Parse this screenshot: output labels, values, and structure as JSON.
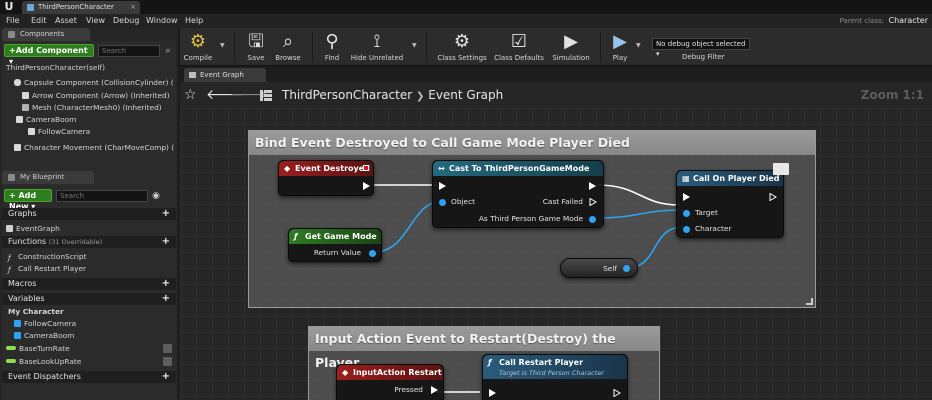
{
  "window": {
    "tab_title": "ThirdPersonCharacter",
    "parent_class_label": "Parent class:",
    "parent_class_value": "Character"
  },
  "menu": [
    "File",
    "Edit",
    "Asset",
    "View",
    "Debug",
    "Window",
    "Help"
  ],
  "components_panel": {
    "tab": "Components",
    "add_button": "+Add Component ▾",
    "search_placeholder": "Search",
    "items": [
      "ThirdPersonCharacter(self)",
      "Capsule Component (CollisionCylinder) (Inherited)",
      "Arrow Component (Arrow) (Inherited)",
      "Mesh (CharacterMesh0) (Inherited)",
      "CameraBoom",
      "FollowCamera",
      "Character Movement (CharMoveComp) (Inherited)"
    ]
  },
  "my_blueprint_panel": {
    "tab": "My Blueprint",
    "add_button": "+ Add New ▾",
    "search_placeholder": "Search",
    "graphs_label": "Graphs",
    "graph_items": [
      "EventGraph"
    ],
    "functions_label": "Functions",
    "functions_count": "(31 Overridable)",
    "function_items": [
      "ConstructionScript",
      "Call Restart Player"
    ],
    "macros_label": "Macros",
    "variables_label": "Variables",
    "variable_category": "My Character",
    "variable_items": [
      "FollowCamera",
      "CameraBoom",
      "BaseTurnRate",
      "BaseLookUpRate"
    ],
    "dispatchers_label": "Event Dispatchers"
  },
  "toolbar": {
    "compile": "Compile",
    "save": "Save",
    "browse": "Browse",
    "find": "Find",
    "hide_unrelated": "Hide Unrelated",
    "class_settings": "Class Settings",
    "class_defaults": "Class Defaults",
    "simulation": "Simulation",
    "play": "Play",
    "debug_object": "No debug object selected ▾",
    "debug_filter": "Debug Filter"
  },
  "graph": {
    "tab": "Event Graph",
    "breadcrumb_root": "ThirdPersonCharacter",
    "breadcrumb_sep": "❯",
    "breadcrumb_leaf": "Event Graph",
    "zoom": "Zoom 1:1"
  },
  "comments": [
    "Bind Event Destroyed to Call Game Mode Player Died",
    "Input Action Event to Restart(Destroy) the Player"
  ],
  "nodes": {
    "event_destroyed": {
      "title": "Event Destroyed"
    },
    "cast": {
      "title": "Cast To ThirdPersonGameMode",
      "object_pin": "Object",
      "cast_failed": "Cast Failed",
      "as_pin": "As Third Person Game Mode"
    },
    "get_game_mode": {
      "title": "Get Game Mode",
      "return_value": "Return Value"
    },
    "call_on_player_died": {
      "title": "Call On Player Died",
      "target": "Target",
      "character": "Character"
    },
    "self": {
      "label": "Self"
    },
    "input_action_restart": {
      "title": "InputAction Restart",
      "pressed": "Pressed"
    },
    "call_restart_player": {
      "title": "Call Restart Player",
      "subtitle": "Target is Third Person Character"
    }
  },
  "colors": {
    "event_header": "#8b1a1a",
    "cast_header": "#1e5a6e",
    "pure_header": "#2c6b22",
    "call_header": "#27506c",
    "data_pin": "#2ea3f2",
    "add_button": "#2e7d1e"
  }
}
